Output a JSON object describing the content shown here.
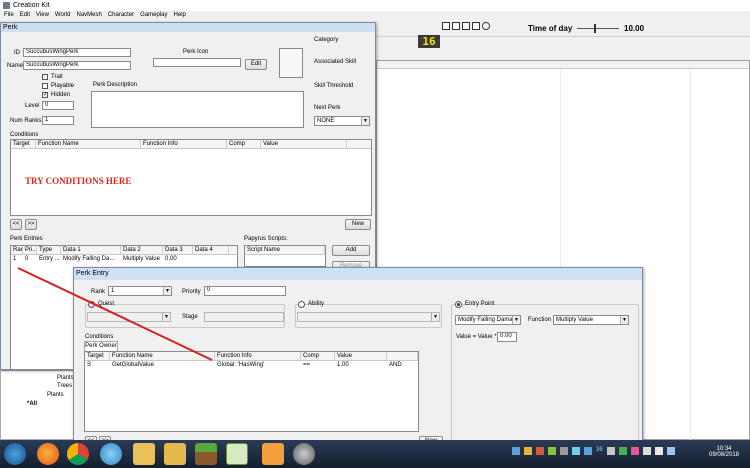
{
  "main_window": {
    "title": "Creation Kit",
    "menu": [
      "File",
      "Edit",
      "View",
      "World",
      "NavMesh",
      "Character",
      "Gameplay",
      "Help"
    ],
    "time_of_day_label": "Time of day",
    "time_of_day_value": "10.00",
    "counter": "16",
    "tree_items": [
      "Plants",
      "Trees",
      "Plants",
      "*All"
    ]
  },
  "perk_window": {
    "title": "Perk",
    "id_label": "ID",
    "id_value": "SuccubusWingPerk",
    "name_label": "Name",
    "name_value": "SuccubusWingPerk",
    "perk_icon_label": "Perk Icon",
    "edit_button": "Edit",
    "trait_label": "Trait",
    "playable_label": "Playable",
    "hidden_label": "Hidden",
    "perk_description_label": "Perk Description",
    "level_label": "Level",
    "level_value": "0",
    "num_ranks_label": "Num Ranks",
    "num_ranks_value": "1",
    "category_label": "Category",
    "associated_skill_label": "Associated Skill",
    "skill_threshold_label": "Skill Threshold",
    "next_perk_label": "Next Perk",
    "next_perk_value": "NONE",
    "conditions_label": "Conditions",
    "conditions_columns": [
      "Target",
      "Function Name",
      "Function Info",
      "Comp",
      "Value"
    ],
    "annotation": "TRY CONDITIONS HERE",
    "nav_prev": "<<",
    "nav_next": ">>",
    "new_button": "New",
    "perk_entries_label": "Perk Entries",
    "entries_columns": [
      "Rank",
      "Pri...",
      "Type",
      "Data 1",
      "Data 2",
      "Data 3",
      "Data 4"
    ],
    "entries_rows": [
      [
        "1",
        "0",
        "Entry ...",
        "Modify Falling Da...",
        "Multiply Value",
        "0.00",
        ""
      ]
    ],
    "papyrus_label": "Papyrus Scripts:",
    "script_name_column": "Script Name",
    "add_button": "Add",
    "remove_button": "Remove"
  },
  "perk_entry_window": {
    "title": "Perk Entry",
    "rank_label": "Rank",
    "rank_value": "1",
    "priority_label": "Priority",
    "priority_value": "0",
    "quest_label": "Quest",
    "stage_label": "Stage",
    "ability_label": "Ability",
    "entry_point_label": "Entry Point",
    "entry_point_value": "Modify Falling Damage",
    "function_label": "Function",
    "function_value": "Multiply Value",
    "formula_label": "Value = Value *",
    "formula_value": "0.00",
    "conditions_label": "Conditions",
    "perk_owner_tab": "Perk Owner",
    "conditions_columns": [
      "Target",
      "Function Name",
      "Function Info",
      "Comp",
      "Value",
      ""
    ],
    "conditions_rows": [
      [
        "S",
        "GetGlobalValue",
        "Global: 'HasWing'",
        "==",
        "1.00",
        "AND"
      ]
    ],
    "nav_prev": "<<",
    "nav_next": ">>",
    "new_button": "New"
  },
  "taskbar": {
    "clock_time": "10:34",
    "clock_date": "09/08/2018",
    "tray_number": "36"
  },
  "colors": {
    "annotation": "#e0241c",
    "arrow": "#d81e1e",
    "counter_bg": "#3a3a3a",
    "counter_fg": "#f2e400"
  }
}
